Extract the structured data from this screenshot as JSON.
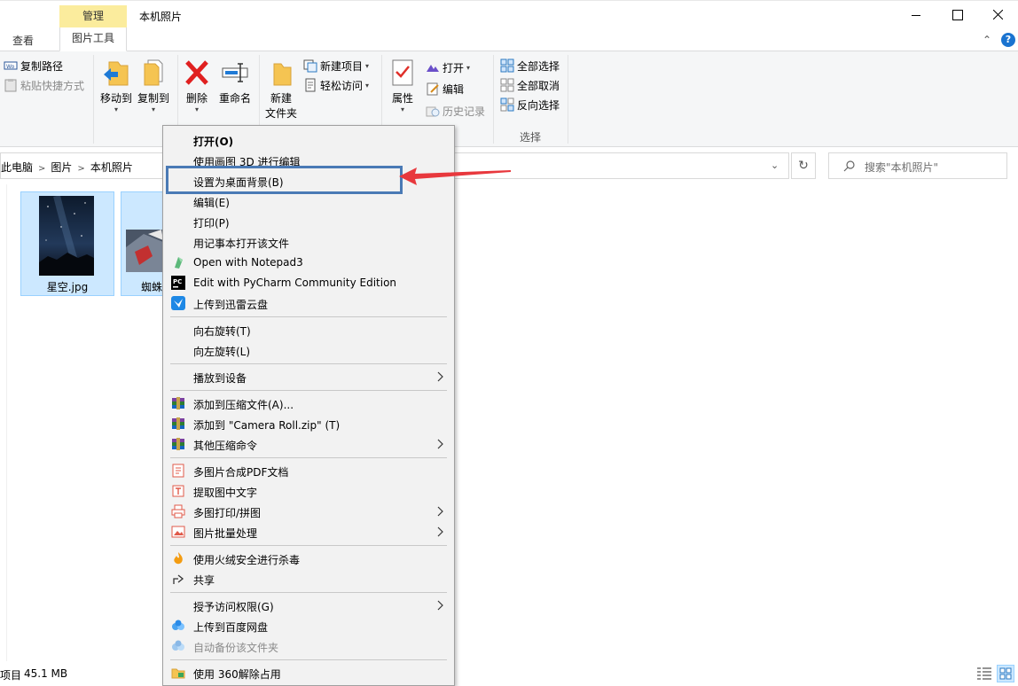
{
  "titlebar": {
    "manage_tab": "管理",
    "window_title": "本机照片"
  },
  "ribbon_tabs": {
    "view": "查看",
    "picture_tools": "图片工具"
  },
  "clipboard": {
    "copy_path": "复制路径",
    "paste_shortcut": "粘贴快捷方式"
  },
  "organize": {
    "move_to": "移动到",
    "copy_to": "复制到",
    "delete": "删除",
    "rename": "重命名"
  },
  "new_group": {
    "new_folder_line1": "新建",
    "new_folder_line2": "文件夹",
    "new_item": "新建项目",
    "easy_access": "轻松访问"
  },
  "open_group": {
    "properties": "属性",
    "open": "打开",
    "edit": "编辑",
    "history": "历史记录"
  },
  "select_group": {
    "select_all": "全部选择",
    "select_none": "全部取消",
    "invert_selection": "反向选择",
    "label": "选择"
  },
  "address": {
    "crumbs": [
      "此电脑",
      "图片",
      "本机照片"
    ],
    "search_placeholder": "搜索\"本机照片\""
  },
  "files": [
    {
      "name": "星空.jpg"
    },
    {
      "name": "蜘蛛"
    }
  ],
  "status": {
    "items_label": "项目",
    "size": "45.1 MB"
  },
  "context_menu": {
    "items": [
      {
        "label": "打开(O)"
      },
      {
        "label": "使用画图 3D 进行编辑"
      },
      {
        "label": "设置为桌面背景(B)"
      },
      {
        "label": "编辑(E)"
      },
      {
        "label": "打印(P)"
      },
      {
        "label": "用记事本打开该文件"
      },
      {
        "label": "Open with Notepad3"
      },
      {
        "label": "Edit with PyCharm Community Edition"
      },
      {
        "label": "上传到迅雷云盘"
      },
      {
        "label": "向右旋转(T)"
      },
      {
        "label": "向左旋转(L)"
      },
      {
        "label": "播放到设备"
      },
      {
        "label": "添加到压缩文件(A)..."
      },
      {
        "label": "添加到 \"Camera Roll.zip\" (T)"
      },
      {
        "label": "其他压缩命令"
      },
      {
        "label": "多图片合成PDF文档"
      },
      {
        "label": "提取图中文字"
      },
      {
        "label": "多图打印/拼图"
      },
      {
        "label": "图片批量处理"
      },
      {
        "label": "使用火绒安全进行杀毒"
      },
      {
        "label": "共享"
      },
      {
        "label": "授予访问权限(G)"
      },
      {
        "label": "上传到百度网盘"
      },
      {
        "label": "自动备份该文件夹"
      },
      {
        "label": "使用 360解除占用"
      }
    ]
  },
  "colors": {
    "accent": "#1a73d0",
    "selection_bg": "#cce8ff",
    "highlight_border": "#4a7ab5",
    "annotation_arrow": "#e8383d",
    "manage_tab": "#fbec9d"
  }
}
